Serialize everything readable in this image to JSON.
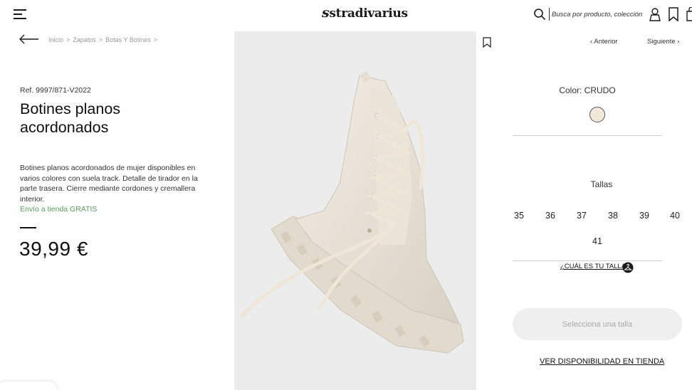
{
  "header": {
    "logo_text": "stradivarius",
    "logo_mark": "s",
    "search": {
      "placeholder": "Busca por producto, colección..."
    }
  },
  "icons": {
    "menu": "hamburger-icon",
    "search": "search-icon",
    "user": "user-icon",
    "wishlist": "bookmark-icon",
    "bag": "bag-icon",
    "back": "arrow-left-icon",
    "size_guide": "hanger-icon"
  },
  "breadcrumb": {
    "items": [
      "Inicio",
      "Zapatos",
      "Botas Y Botines"
    ],
    "separator": ">"
  },
  "product": {
    "ref": "Ref. 9997/871-V2022",
    "title": "Botines planos acordonados",
    "description": "Botines planos acordonados de mujer disponibles en varios colores con suela track. Detalle de tirador en la parte trasera. Cierre mediante cordones y cremallera interior.",
    "shipping": "Envío a tienda GRATIS",
    "price": "39,99 €"
  },
  "navigation": {
    "prev": "Anterior",
    "next": "Siguiente"
  },
  "color": {
    "label": "Color: CRUDO",
    "swatch_hex": "#f2e6d8"
  },
  "sizes": {
    "label": "Tallas",
    "options": [
      "35",
      "36",
      "37",
      "38",
      "39",
      "40",
      "41"
    ]
  },
  "size_guide": "¿CUÁL ES TU TALLA?",
  "actions": {
    "select_size": "Selecciona una talla",
    "store_availability": "VER DISPONIBILIDAD EN TIENDA"
  },
  "colors": {
    "shipping_green": "#5a9a5a",
    "image_bg": "#ececec",
    "button_bg": "#efefef"
  }
}
